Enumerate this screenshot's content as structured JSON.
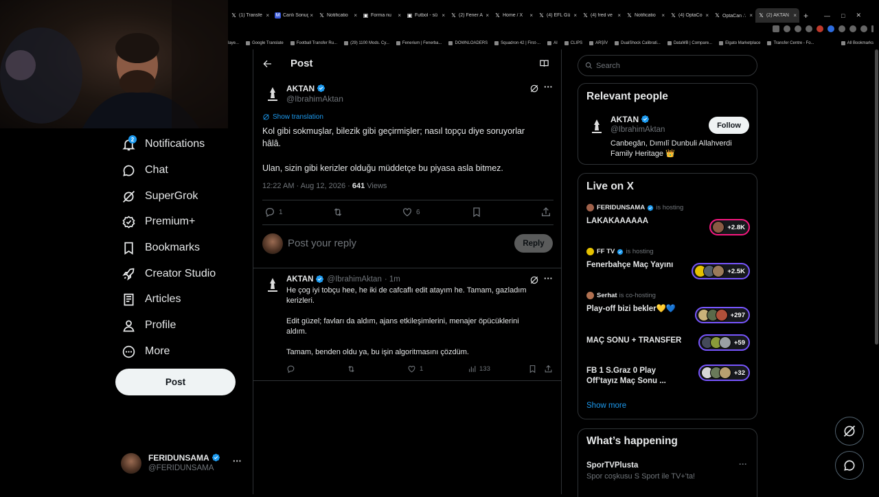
{
  "browser": {
    "tabs": [
      {
        "label": "(1) Transfe",
        "icon": "x-icon"
      },
      {
        "label": "Canlı Sonuç",
        "icon": "m-icon"
      },
      {
        "label": "Notificatio",
        "icon": "x-icon"
      },
      {
        "label": "Forma nu",
        "icon": "page-icon"
      },
      {
        "label": "Futbol - sü",
        "icon": "page-icon"
      },
      {
        "label": "(2) Fener A",
        "icon": "x-icon"
      },
      {
        "label": "Home / X",
        "icon": "x-icon"
      },
      {
        "label": "(4) EFL Gü",
        "icon": "x-icon"
      },
      {
        "label": "(4) fred ve",
        "icon": "x-icon"
      },
      {
        "label": "Notificatio",
        "icon": "x-icon"
      },
      {
        "label": "(4) OptaCo",
        "icon": "x-icon"
      },
      {
        "label": "OptaCan ∴",
        "icon": "x-icon"
      },
      {
        "label": "(2) AKTAN",
        "icon": "x-icon",
        "active": true
      }
    ],
    "bookmarks": [
      "laye...",
      "Google Translate",
      "Football Transfer Ru...",
      "(29) 1100 Mods. Cy...",
      "Fenerium | Fenerba...",
      "DOWNLOADERS",
      "Squadron 42 | First-...",
      "AI",
      "CLIPS",
      "ARŞİV",
      "DualShock Calibrati...",
      "DataMB | Compare...",
      "Elgato Marketplace",
      "Transfer Centre - Fo...",
      "All Bookmarks"
    ]
  },
  "nav": {
    "notifications_badge": "2",
    "items": [
      {
        "label": "Notifications",
        "icon": "bell-icon"
      },
      {
        "label": "Chat",
        "icon": "chat-icon"
      },
      {
        "label": "SuperGrok",
        "icon": "grok-icon"
      },
      {
        "label": "Premium+",
        "icon": "premium-icon"
      },
      {
        "label": "Bookmarks",
        "icon": "bookmark-icon"
      },
      {
        "label": "Creator Studio",
        "icon": "rocket-icon"
      },
      {
        "label": "Articles",
        "icon": "articles-icon"
      },
      {
        "label": "Profile",
        "icon": "person-icon"
      },
      {
        "label": "More",
        "icon": "more-circle-icon"
      }
    ],
    "post_button": "Post",
    "account": {
      "name": "FERIDUNSAMA",
      "handle": "@FERIDUNSAMA",
      "menu": "···"
    }
  },
  "main": {
    "header_title": "Post",
    "post": {
      "name": "AKTAN",
      "handle": "@IbrahimAktan",
      "show_translation": "Show translation",
      "text_line1": "Kol gibi sokmuşlar, bilezik gibi geçirmişler; nasıl topçu diye soruyorlar",
      "text_line2": "hâlâ.",
      "text_line3": "Ulan, sizin gibi kerizler olduğu müddetçe bu piyasa asla bitmez.",
      "timestamp": "12:22 AM · Aug 12, 2026 · ",
      "views_count": "641",
      "views_label": " Views",
      "replies": "1",
      "reposts": "",
      "likes": "6"
    },
    "reply_box": {
      "placeholder": "Post your reply",
      "button": "Reply"
    },
    "reply": {
      "name": "AKTAN",
      "handle": "@IbrahimAktan",
      "time": "· 1m",
      "text_line1": "He çog iyi tobçu hee, he iki de cafcaflı edit atayım he. Tamam, gazladım",
      "text_line2": "kerizleri.",
      "text_line3": "Edit güzel; favları da aldım, ajans etkileşimlerini, menajer öpücüklerini",
      "text_line4": "aldım.",
      "text_line5": "Tamam, benden oldu ya, bu işin algoritmasını çözdüm.",
      "likes": "1",
      "views": "133"
    }
  },
  "sidebar": {
    "search_placeholder": "Search",
    "relevant": {
      "title": "Relevant people",
      "name": "AKTAN",
      "handle": "@IbrahimAktan",
      "bio_line1": "Canbegân, Dımılî Dunbuli Allahverdi",
      "bio_line2": "Family Heritage 👑",
      "follow": "Follow"
    },
    "live": {
      "title": "Live on X",
      "items": [
        {
          "host": "FERIDUNSAMA",
          "status": "is hosting",
          "title1": "LAKAKAAAAAA",
          "title2": "",
          "count": "+2.8K"
        },
        {
          "host": "FF TV",
          "status": "is hosting",
          "title1": "Fenerbahçe Maç Yayını",
          "title2": "",
          "count": "+2.5K"
        },
        {
          "host": "Serhat",
          "status": "is co-hosting",
          "title1": "Play-off bizi bekler💛💙",
          "title2": "",
          "count": "+297"
        },
        {
          "host": "",
          "status": "",
          "title1": "MAÇ SONU + TRANSFER",
          "title2": "",
          "count": "+59"
        },
        {
          "host": "",
          "status": "",
          "title1": "FB 1 S.Graz 0 Play",
          "title2": "Off’tayız Maç Sonu ...",
          "count": "+32"
        }
      ],
      "show_more": "Show more"
    },
    "happening": {
      "title": "What’s happening",
      "item_title": "SporTVPlusta",
      "item_sub": "Spor coşkusu S Sport ile TV+'ta!",
      "menu": "···"
    }
  },
  "colors": {
    "accent": "#1d9bf0",
    "border": "#2f3336",
    "muted": "#71767b",
    "live_purple": "#7856ff",
    "live_pink": "#f91880"
  }
}
